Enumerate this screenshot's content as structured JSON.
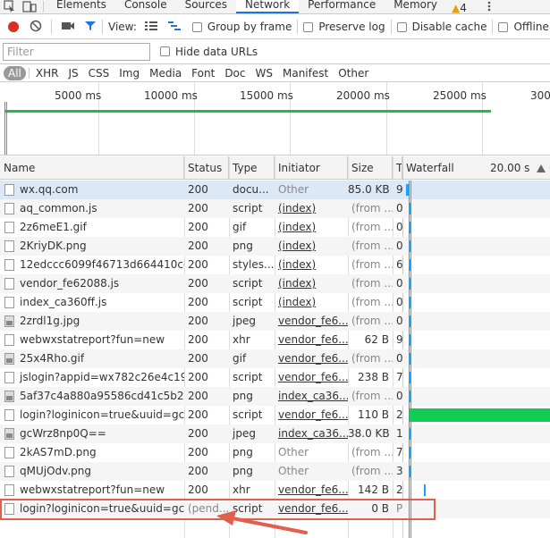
{
  "devtools": {
    "tabs": [
      "Elements",
      "Console",
      "Sources",
      "Network",
      "Performance",
      "Memory"
    ],
    "active_tab": "Network",
    "warning_count": "4"
  },
  "toolbar": {
    "view_label": "View:",
    "group_by_frame": "Group by frame",
    "preserve_log": "Preserve log",
    "disable_cache": "Disable cache",
    "offline": "Offline"
  },
  "filter": {
    "placeholder": "Filter",
    "hide_data_urls": "Hide data URLs"
  },
  "types": [
    "All",
    "XHR",
    "JS",
    "CSS",
    "Img",
    "Media",
    "Font",
    "Doc",
    "WS",
    "Manifest",
    "Other"
  ],
  "overview": {
    "ticks": [
      "5000 ms",
      "10000 ms",
      "15000 ms",
      "20000 ms",
      "25000 ms",
      "300"
    ]
  },
  "columns": {
    "name": "Name",
    "status": "Status",
    "type": "Type",
    "initiator": "Initiator",
    "size": "Size",
    "time": "T",
    "waterfall": "Waterfall",
    "waterfall_time": "20.00 s"
  },
  "requests": [
    {
      "name": "wx.qq.com",
      "status": "200",
      "type": "docu...",
      "initiator": "Other",
      "size": "85.0 KB",
      "time": "9",
      "icon": "doc"
    },
    {
      "name": "aq_common.js",
      "status": "200",
      "type": "script",
      "initiator": "(index)",
      "size": "(from ...",
      "time": "0",
      "icon": "doc"
    },
    {
      "name": "2z6meE1.gif",
      "status": "200",
      "type": "gif",
      "initiator": "(index)",
      "size": "(from ...",
      "time": "0",
      "icon": "doc"
    },
    {
      "name": "2KriyDK.png",
      "status": "200",
      "type": "png",
      "initiator": "(index)",
      "size": "(from ...",
      "time": "0",
      "icon": "doc"
    },
    {
      "name": "12edccc6099f46713d664410cd7...",
      "status": "200",
      "type": "styles...",
      "initiator": "(index)",
      "size": "(from ...",
      "time": "6",
      "icon": "doc"
    },
    {
      "name": "vendor_fe62088.js",
      "status": "200",
      "type": "script",
      "initiator": "(index)",
      "size": "(from ...",
      "time": "0",
      "icon": "doc"
    },
    {
      "name": "index_ca360ff.js",
      "status": "200",
      "type": "script",
      "initiator": "(index)",
      "size": "(from ...",
      "time": "0",
      "icon": "doc"
    },
    {
      "name": "2zrdl1g.jpg",
      "status": "200",
      "type": "jpeg",
      "initiator": "vendor_fe6...",
      "size": "(from ...",
      "time": "0",
      "icon": "img"
    },
    {
      "name": "webwxstatreport?fun=new",
      "status": "200",
      "type": "xhr",
      "initiator": "vendor_fe6...",
      "size": "62 B",
      "time": "9",
      "icon": "doc"
    },
    {
      "name": "25x4Rho.gif",
      "status": "200",
      "type": "gif",
      "initiator": "vendor_fe6...",
      "size": "(from ...",
      "time": "0",
      "icon": "img"
    },
    {
      "name": "jslogin?appid=wx782c26e4c19a...",
      "status": "200",
      "type": "script",
      "initiator": "vendor_fe6...",
      "size": "238 B",
      "time": "7",
      "icon": "doc"
    },
    {
      "name": "5af37c4a880a95586cd41c5b251...",
      "status": "200",
      "type": "png",
      "initiator": "index_ca36...",
      "size": "(from ...",
      "time": "0",
      "icon": "img"
    },
    {
      "name": "login?loginicon=true&uuid=gc...",
      "status": "200",
      "type": "script",
      "initiator": "vendor_fe6...",
      "size": "110 B",
      "time": "2",
      "icon": "doc"
    },
    {
      "name": "gcWrz8np0Q==",
      "status": "200",
      "type": "jpeg",
      "initiator": "index_ca36...",
      "size": "38.0 KB",
      "time": "1",
      "icon": "img"
    },
    {
      "name": "2kAS7mD.png",
      "status": "200",
      "type": "png",
      "initiator": "Other",
      "size": "(from ...",
      "time": "7",
      "icon": "doc"
    },
    {
      "name": "qMUjOdv.png",
      "status": "200",
      "type": "png",
      "initiator": "Other",
      "size": "(from ...",
      "time": "3",
      "icon": "doc"
    },
    {
      "name": "webwxstatreport?fun=new",
      "status": "200",
      "type": "xhr",
      "initiator": "vendor_fe6...",
      "size": "142 B",
      "time": "2",
      "icon": "doc"
    },
    {
      "name": "login?loginicon=true&uuid=gc...",
      "status": "(pend...",
      "type": "script",
      "initiator": "vendor_fe6...",
      "size": "0 B",
      "time": "P",
      "icon": "doc"
    }
  ],
  "colors": {
    "accent": "#1a73e8",
    "waterfall_bar": "#1aa3ff",
    "long_bar": "#11cc55",
    "highlight": "#e06050"
  }
}
